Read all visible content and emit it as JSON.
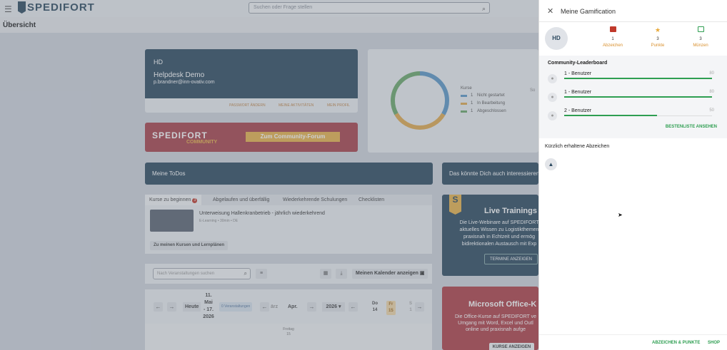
{
  "app": {
    "logo_text": "SPEDIFORT",
    "search_placeholder": "Suchen oder Frage stellen",
    "page_title": "Übersicht"
  },
  "user_card": {
    "initials": "HD",
    "name": "Helpdesk Demo",
    "email": "p.brandner@inn-ovativ.com",
    "actions": [
      "PASSWORT ÄNDERN",
      "MEINE AKTIVITÄTEN",
      "MEIN PROFIL"
    ]
  },
  "kurse": {
    "legend_title": "Kurse",
    "items": [
      {
        "count": "1",
        "label": "Nicht gestartet",
        "color": "#5b97c7"
      },
      {
        "count": "1",
        "label": "In Bearbeitung",
        "color": "#e0a94e"
      },
      {
        "count": "1",
        "label": "Abgeschlossen",
        "color": "#6aa86a"
      }
    ],
    "side_text": "So"
  },
  "banner": {
    "brand": "SPEDIFORT",
    "sub": "COMMUNITY",
    "button": "Zum Community-Forum"
  },
  "todos": {
    "title": "Meine ToDos"
  },
  "interest": {
    "title": "Das könnte Dich auch interessieren"
  },
  "tabs": [
    {
      "label": "Kurse zu beginnen",
      "badge": "3"
    },
    {
      "label": "Abgelaufen und überfällig"
    },
    {
      "label": "Wiederkehrende Schulungen"
    },
    {
      "label": "Checklisten"
    }
  ],
  "course": {
    "title": "Unterweisung Hallenkranbetrieb - jährlich wiederkehrend",
    "meta": "E-Learning • 30min • DE",
    "button": "Zu meinen Kursen und Lernplänen"
  },
  "events": {
    "search_placeholder": "Nach Veranstaltungen suchen",
    "calendar_button": "Meinen Kalender anzeigen"
  },
  "calendar": {
    "today": "Heute",
    "range": [
      "11.",
      "Mai",
      "- 17.",
      "2026"
    ],
    "events_count": "0 Veranstaltungen",
    "month_prev": "ärz",
    "month": "Apr.",
    "year": "2026",
    "days": [
      {
        "name": "Do",
        "num": "14"
      },
      {
        "name": "Fr",
        "num": "15"
      },
      {
        "name": "S",
        "num": "1"
      }
    ],
    "sub_day": "Freitag",
    "sub_num": "15"
  },
  "live": {
    "badge": "S",
    "title": "Live Trainings",
    "desc": "Die Live-Webinare auf SPEDIFORT\naktuelles Wissen zu Logistikthemen\npraxisnah in Echtzeit und ermög\nbidirektionalen Austausch mit Exp",
    "button": "TERMINE ANZEIGEN"
  },
  "ms": {
    "title": "Microsoft Office-K",
    "desc": "Die Office-Kurse auf SPEDIFORT ve\nUmgang mit Word, Excel und Outl\nonline und praxisnah aufge",
    "button": "KURSE ANZEIGEN"
  },
  "panel": {
    "title": "Meine Gamification",
    "avatar": "HD",
    "stats": [
      {
        "num": "1",
        "label": "Abzeichen",
        "icon": "badge-icon",
        "color": "#c0392b"
      },
      {
        "num": "3",
        "label": "Punkte",
        "icon": "star-icon",
        "color": "#e8a838"
      },
      {
        "num": "3",
        "label": "Münzen",
        "icon": "coin-icon",
        "color": "#2e9e51"
      }
    ],
    "leaderboard_title": "Community-Leaderboard",
    "leaderboard": [
      {
        "name": "1 - Benutzer",
        "value": "80",
        "progress": 1.0
      },
      {
        "name": "1 - Benutzer",
        "value": "80",
        "progress": 1.0
      },
      {
        "name": "2 - Benutzer",
        "value": "50",
        "progress": 0.63
      }
    ],
    "leaderboard_link": "BESTENLISTE ANSEHEN",
    "recent_title": "Kürzlich erhaltene Abzeichen",
    "footer_left": "ABZEICHEN & PUNKTE",
    "footer_right": "SHOP"
  }
}
